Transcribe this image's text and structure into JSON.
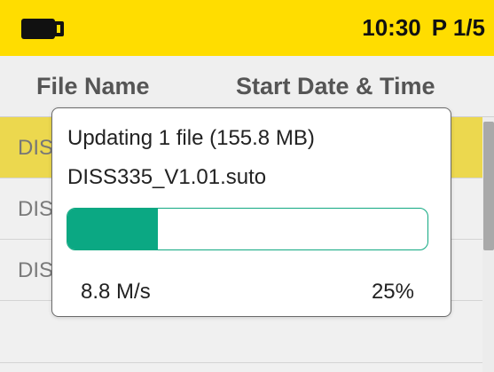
{
  "status_bar": {
    "time": "10:30",
    "page": "P 1/5",
    "icon": "battery-icon"
  },
  "table": {
    "columns": [
      "File Name",
      "Start Date & Time"
    ],
    "rows": [
      {
        "file_name": "DIS"
      },
      {
        "file_name": "DIS"
      },
      {
        "file_name": "DIS"
      }
    ]
  },
  "dialog": {
    "title": "Updating 1 file (155.8 MB)",
    "filename": "DISS335_V1.01.suto",
    "progress_percent": 25,
    "speed": "8.8 M/s",
    "percent_label": "25%"
  },
  "colors": {
    "status_bar": "#ffdd00",
    "selected_row": "#ecd84e",
    "progress": "#0ba883"
  }
}
